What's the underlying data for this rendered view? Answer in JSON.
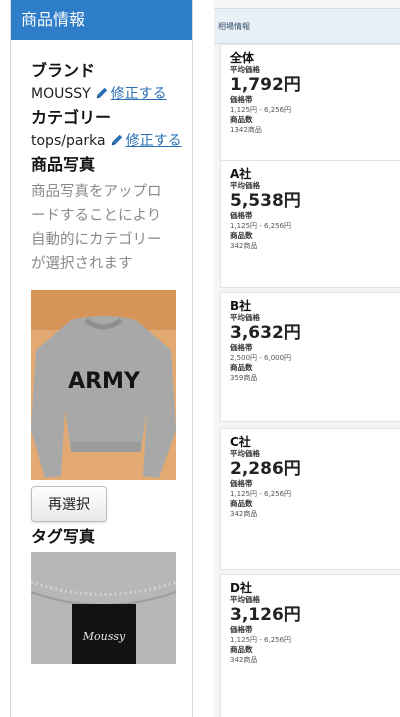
{
  "left": {
    "header": "商品情報",
    "brand": {
      "label": "ブランド",
      "value": "MOUSSY",
      "edit": "修正する"
    },
    "category": {
      "label": "カテゴリー",
      "value": "tops/parka",
      "edit": "修正する"
    },
    "photo": {
      "label": "商品写真",
      "description": "商品写真をアップロードすることにより自動的にカテゴリーが選択されます",
      "print": "ARMY"
    },
    "reselect_button": "再選択",
    "tag_photo": {
      "label": "タグ写真",
      "brand_mark": "Moussy"
    }
  },
  "right": {
    "header": "相場情報",
    "cards": [
      {
        "title": "全体",
        "avg_label": "平均価格",
        "avg": "1,792円",
        "range_label": "価格帯",
        "range": "1,125円 - 6,256円",
        "count_label": "商品数",
        "count": "1342商品"
      },
      {
        "title": "A社",
        "avg_label": "平均価格",
        "avg": "5,538円",
        "range_label": "価格帯",
        "range": "1,125円 - 6,256円",
        "count_label": "商品数",
        "count": "342商品"
      },
      {
        "title": "B社",
        "avg_label": "平均価格",
        "avg": "3,632円",
        "range_label": "価格帯",
        "range": "2,500円 - 6,000円",
        "count_label": "商品数",
        "count": "359商品"
      },
      {
        "title": "C社",
        "avg_label": "平均価格",
        "avg": "2,286円",
        "range_label": "価格帯",
        "range": "1,125円 - 6,256円",
        "count_label": "商品数",
        "count": "342商品"
      },
      {
        "title": "D社",
        "avg_label": "平均価格",
        "avg": "3,126円",
        "range_label": "価格帯",
        "range": "1,125円 - 6,256円",
        "count_label": "商品数",
        "count": "342商品"
      }
    ]
  }
}
